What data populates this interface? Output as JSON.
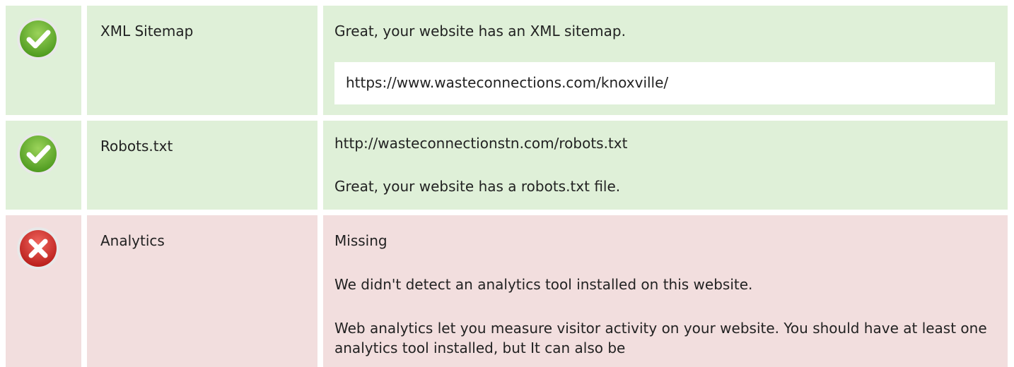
{
  "rows": [
    {
      "status": "pass",
      "icon": "check-icon",
      "label": "XML Sitemap",
      "message": "Great, your website has an XML sitemap.",
      "url": "https://www.wasteconnections.com/knoxville/"
    },
    {
      "status": "pass",
      "icon": "check-icon",
      "label": "Robots.txt",
      "url": "http://wasteconnectionstn.com/robots.txt",
      "message": "Great, your website has a robots.txt file."
    },
    {
      "status": "fail",
      "icon": "cross-icon",
      "label": "Analytics",
      "status_text": "Missing",
      "message": "We didn't detect an analytics tool installed on this website.",
      "description": "Web analytics let you measure visitor activity on your website. You should have at least one analytics tool installed, but It can also be"
    }
  ],
  "colors": {
    "pass_bg": "#dff0d8",
    "fail_bg": "#f2dede",
    "pass_icon": "#6cb43a",
    "fail_icon": "#d9332f"
  }
}
